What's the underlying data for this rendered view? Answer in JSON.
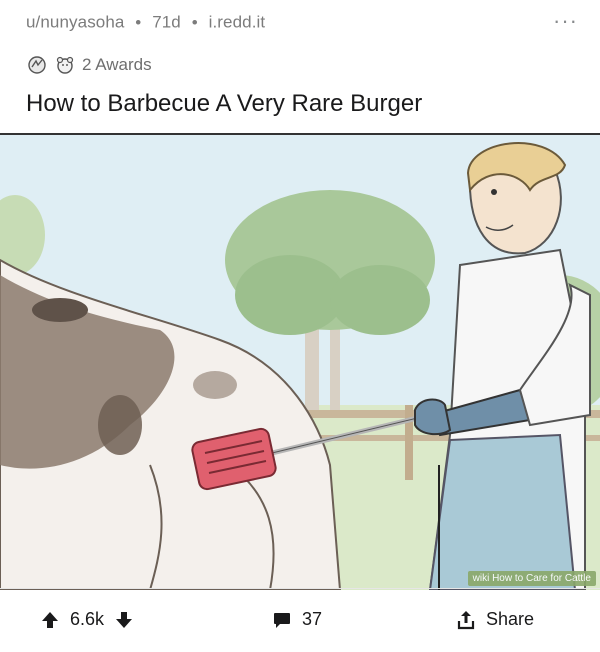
{
  "post": {
    "author": "u/nunyasoha",
    "age": "71d",
    "domain": "i.redd.it",
    "more_label": "···",
    "awards_label": "2 Awards",
    "title": "How to Barbecue A Very Rare Burger"
  },
  "image": {
    "watermark": "wiki How to Care for Cattle"
  },
  "actions": {
    "score": "6.6k",
    "comments": "37",
    "share_label": "Share"
  },
  "icons": {
    "upvote": "up-arrow-icon",
    "downvote": "down-arrow-icon",
    "comment": "speech-bubble-icon",
    "share": "share-upload-icon"
  }
}
